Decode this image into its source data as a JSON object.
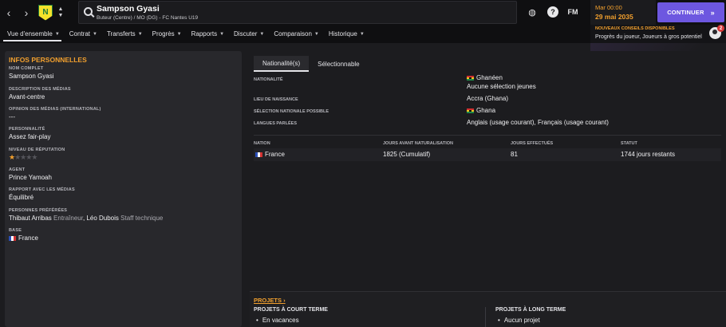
{
  "header": {
    "player_name": "Sampson Gyasi",
    "player_sub": "Buteur (Centre) / MO (DG) - FC Nantes U19",
    "date_time": "Mar 00:00",
    "date_day": "29 mai 2035",
    "continue_label": "CONTINUER",
    "fm_label": "FM"
  },
  "nav": {
    "items": [
      {
        "label": "Vue d'ensemble"
      },
      {
        "label": "Contrat"
      },
      {
        "label": "Transferts"
      },
      {
        "label": "Progrès"
      },
      {
        "label": "Rapports"
      },
      {
        "label": "Discuter"
      },
      {
        "label": "Comparaison"
      },
      {
        "label": "Historique"
      }
    ]
  },
  "advice": {
    "title": "NOUVEAUX CONSEILS DISPONIBLES",
    "text": "Progrès du joueur, Joueurs à gros potentiel",
    "badge": "2"
  },
  "personal": {
    "title": "INFOS PERSONNELLES",
    "full_name_label": "NOM COMPLET",
    "full_name": "Sampson Gyasi",
    "media_desc_label": "DESCRIPTION DES MÉDIAS",
    "media_desc": "Avant-centre",
    "media_opinion_label": "OPINION DES MÉDIAS (INTERNATIONAL)",
    "media_opinion": "---",
    "personality_label": "PERSONNALITÉ",
    "personality": "Assez fair-play",
    "reputation_label": "NIVEAU DE RÉPUTATION",
    "reputation_stars": 1,
    "reputation_max": 5,
    "agent_label": "AGENT",
    "agent": "Prince Yamoah",
    "media_relation_label": "RAPPORT AVEC LES MÉDIAS",
    "media_relation": "Équilibré",
    "favoured_label": "PERSONNES PRÉFÉRÉES",
    "favoured_1_name": "Thibaut Arribas",
    "favoured_1_role": "Entraîneur",
    "favoured_2_name": "Léo Dubois",
    "favoured_2_role": "Staff technique",
    "base_label": "BASE",
    "base": "France"
  },
  "nationality": {
    "tabs": [
      "Nationalité(s)",
      "Sélectionnable"
    ],
    "nationality_label": "NATIONALITÉ",
    "nationality": "Ghanéen",
    "youth_selection": "Aucune sélection jeunes",
    "birthplace_label": "LIEU DE NAISSANCE",
    "birthplace": "Accra (Ghana)",
    "possible_label": "SÉLECTION NATIONALE POSSIBLE",
    "possible": "Ghana",
    "languages_label": "LANGUES PARLÉES",
    "languages": "Anglais (usage courant), Français (usage courant)"
  },
  "naturalisation": {
    "headers": [
      "NATION",
      "JOURS AVANT NATURALISATION",
      "JOURS EFFECTUÉS",
      "STATUT"
    ],
    "row": {
      "nation": "France",
      "days_before": "1825 (Cumulatif)",
      "days_done": "81",
      "status": "1744 jours restants"
    }
  },
  "projects": {
    "title": "PROJETS",
    "short_title": "PROJETS À COURT TERME",
    "short_item": "En vacances",
    "long_title": "PROJETS À LONG TERME",
    "long_item": "Aucun projet"
  },
  "colors": {
    "accent": "#f2a02e",
    "continue": "#6d57e0"
  }
}
